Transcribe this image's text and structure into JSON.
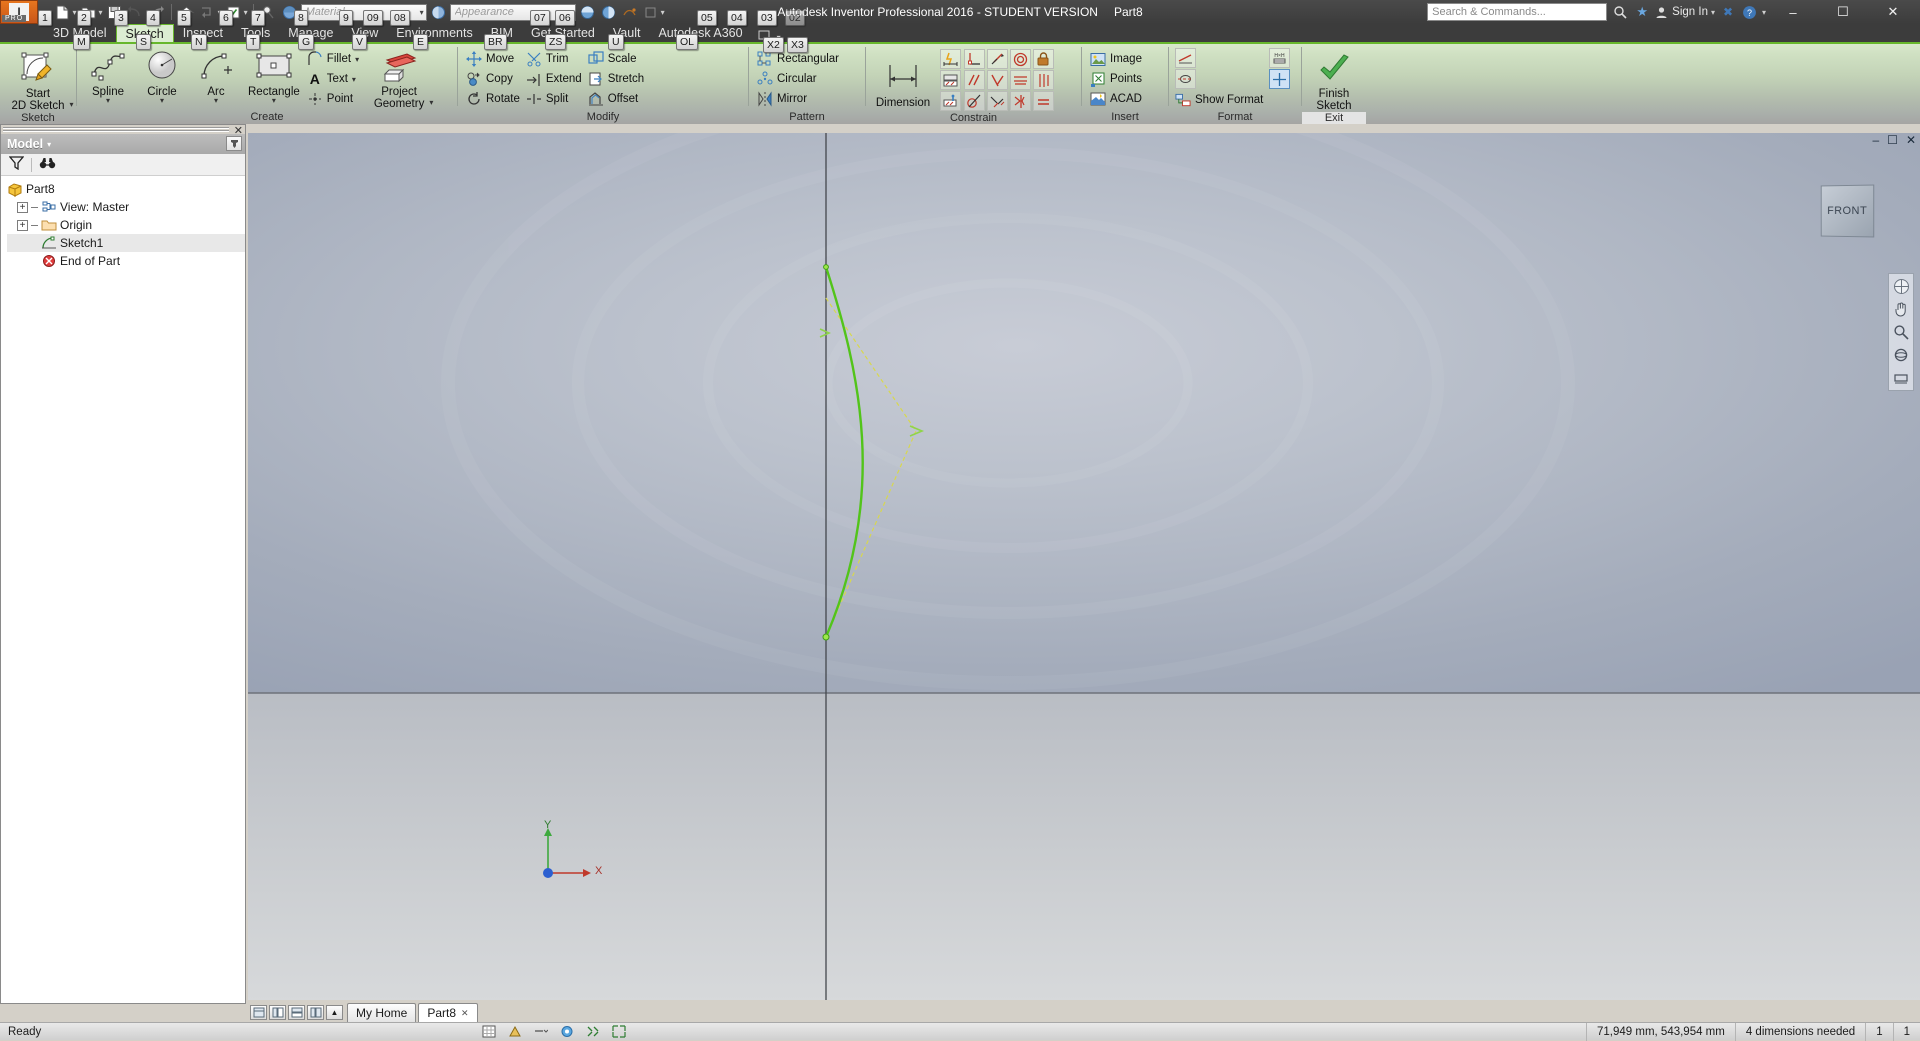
{
  "window": {
    "app_title": "Autodesk Inventor Professional 2016 - STUDENT VERSION",
    "document_name": "Part8",
    "minimize": "–",
    "maximize": "☐",
    "close": "✕"
  },
  "inventor_button": {
    "label": "I",
    "pro_label": "PRO",
    "caret": "▾"
  },
  "quick_access": {
    "items": [
      {
        "name": "new-button",
        "keytip": "1",
        "has_dropdown": true
      },
      {
        "name": "open-button",
        "keytip": "2",
        "has_dropdown": false
      },
      {
        "name": "save-button",
        "keytip": "3",
        "has_dropdown": false
      },
      {
        "name": "undo-button",
        "keytip": "4",
        "has_dropdown": false
      },
      {
        "name": "redo-button",
        "keytip": "5",
        "has_dropdown": false
      },
      {
        "name": "home-button",
        "keytip": "6",
        "has_dropdown": false
      },
      {
        "name": "return-button",
        "keytip": "7",
        "has_dropdown": true
      },
      {
        "name": "update-button",
        "keytip": "8",
        "has_dropdown": true
      },
      {
        "name": "select-button",
        "keytip": "9",
        "has_dropdown": false
      },
      {
        "name": "material-browser-button",
        "keytip": "09",
        "has_dropdown": false
      }
    ],
    "material_combo": {
      "keytip": "08",
      "value": "Material",
      "caret": "▾"
    },
    "appearance_combo": {
      "keytip": "06",
      "value": "Appearance",
      "caret": "▾"
    },
    "appearance_button_keytip": "07",
    "right_items": [
      {
        "name": "appearance-swatch-1",
        "keytip": "05"
      },
      {
        "name": "appearance-swatch-2",
        "keytip": "04"
      },
      {
        "name": "clear-appearance-button",
        "keytip": "03"
      },
      {
        "name": "adjust-button",
        "keytip": "02"
      }
    ]
  },
  "title_right": {
    "search_placeholder": "Search & Commands...",
    "help_icon": "?",
    "star_icon": "★",
    "signin_label": "Sign In",
    "x_icon": "✖"
  },
  "tabs": [
    {
      "label": "3D Model",
      "keytip": "M",
      "active": false
    },
    {
      "label": "Sketch",
      "keytip": "S",
      "active": true
    },
    {
      "label": "Inspect",
      "keytip": "N",
      "active": false
    },
    {
      "label": "Tools",
      "keytip": "T",
      "active": false
    },
    {
      "label": "Manage",
      "keytip": "G",
      "active": false
    },
    {
      "label": "View",
      "keytip": "V",
      "active": false
    },
    {
      "label": "Environments",
      "keytip": "E",
      "active": false
    },
    {
      "label": "BIM",
      "keytip": "BR",
      "active": false
    },
    {
      "label": "Get Started",
      "keytip": "ZS",
      "active": false
    },
    {
      "label": "Vault",
      "keytip": "U",
      "active": false
    },
    {
      "label": "Autodesk A360",
      "keytip": "OL",
      "active": false
    }
  ],
  "ribbon": {
    "panels": [
      {
        "title": "Sketch"
      },
      {
        "title": "Create"
      },
      {
        "title": "Modify"
      },
      {
        "title": "Pattern"
      },
      {
        "title": "Constrain"
      },
      {
        "title": "Insert"
      },
      {
        "title": "Format"
      },
      {
        "title": "Exit"
      }
    ],
    "sketch_panel": {
      "start_2d_sketch": {
        "line1": "Start",
        "line2": "2D Sketch"
      }
    },
    "create_panel": {
      "spline": "Spline",
      "circle": "Circle",
      "arc": "Arc",
      "rectangle": "Rectangle",
      "fillet": "Fillet",
      "text": "Text",
      "point": "Point",
      "project_geometry": {
        "line1": "Project",
        "line2": "Geometry"
      }
    },
    "modify_panel": {
      "move": "Move",
      "copy": "Copy",
      "rotate": "Rotate",
      "trim": "Trim",
      "extend": "Extend",
      "split": "Split",
      "scale": "Scale",
      "stretch": "Stretch",
      "offset": "Offset"
    },
    "pattern_panel": {
      "rectangular": "Rectangular",
      "circular": "Circular",
      "mirror": "Mirror"
    },
    "constrain_panel": {
      "dimension": "Dimension"
    },
    "insert_panel": {
      "image": "Image",
      "points": "Points",
      "acad": "ACAD"
    },
    "format_panel": {
      "show_format": "Show Format"
    },
    "exit_panel": {
      "finish_sketch": {
        "line1": "Finish",
        "line2": "Sketch"
      }
    },
    "dimension_keytips": {
      "x2": "X2",
      "x3": "X3"
    }
  },
  "browser": {
    "panel_title": "Model",
    "panel_caret": "▾",
    "close": "✕",
    "filter_icon": "filter-icon",
    "find_icon": "binoculars-icon",
    "tree": [
      {
        "label": "Part8",
        "icon": "part-icon",
        "indent": 0,
        "expander": "none",
        "selected": false
      },
      {
        "label": "View: Master",
        "icon": "view-icon",
        "indent": 1,
        "expander": "+",
        "selected": false
      },
      {
        "label": "Origin",
        "icon": "folder-icon",
        "indent": 1,
        "expander": "+",
        "selected": false
      },
      {
        "label": "Sketch1",
        "icon": "sketch-icon",
        "indent": 1,
        "expander": "none",
        "selected": true
      },
      {
        "label": "End of Part",
        "icon": "end-of-part-icon",
        "indent": 1,
        "expander": "none",
        "selected": false
      }
    ]
  },
  "graphics": {
    "view_cube_label": "FRONT",
    "axis_x_label": "X",
    "axis_y_label": "Y",
    "window_minimize": "–",
    "window_restore": "☐",
    "window_close": "✕",
    "navbar_icons": [
      "full-nav-wheel-icon",
      "pan-icon",
      "zoom-icon",
      "orbit-icon",
      "look-at-icon"
    ]
  },
  "bottom_tabs": {
    "view_modes": [
      "model-view-icon",
      "two-pane-icon",
      "tile-horizontal-icon",
      "tile-vertical-icon"
    ],
    "collapse_icon": "▲",
    "tabs": [
      {
        "label": "My Home",
        "active": false,
        "closable": false
      },
      {
        "label": "Part8",
        "active": true,
        "closable": true,
        "close": "✕"
      }
    ]
  },
  "status_bar": {
    "left": "Ready",
    "coordinates": "71,949 mm, 543,954 mm",
    "dimensions_needed": "4 dimensions needed",
    "count_1": "1",
    "count_2": "1",
    "center_icons": [
      "grid-icon",
      "snap-icon",
      "dropdown-icon",
      "record-icon",
      "annotate-icon",
      "expand-icon"
    ]
  },
  "colors": {
    "accent_green": "#67b72c",
    "titlebar": "#3c3c3c",
    "ribbon_top": "#d8e8cc",
    "sketch_curve": "#52c41a",
    "construction": "#d4d44a",
    "orange": "#e8761e"
  }
}
